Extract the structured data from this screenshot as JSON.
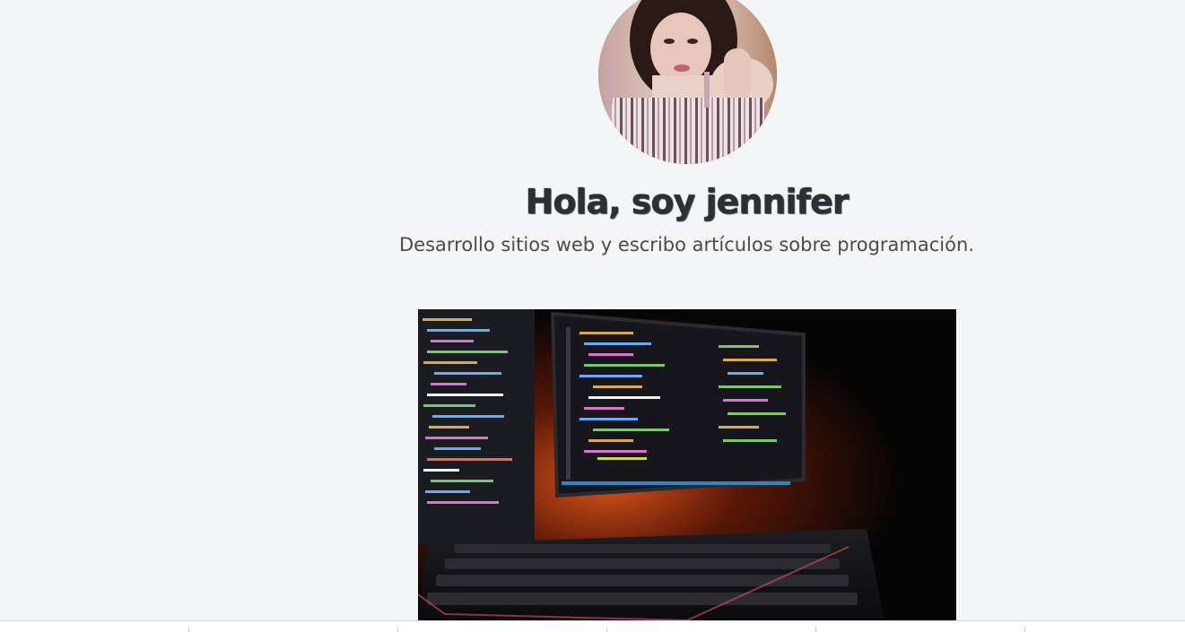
{
  "profile": {
    "avatar_alt": "Jennifer",
    "greeting": "Hola, soy jennifer",
    "tagline": "Desarrollo sitios web y escribo artículos sobre programación."
  },
  "hero_image": {
    "alt": "Monitores con código y teclado"
  },
  "colors": {
    "background": "#f4f5f7",
    "title": "#2b2f36",
    "tagline": "#54474a"
  }
}
